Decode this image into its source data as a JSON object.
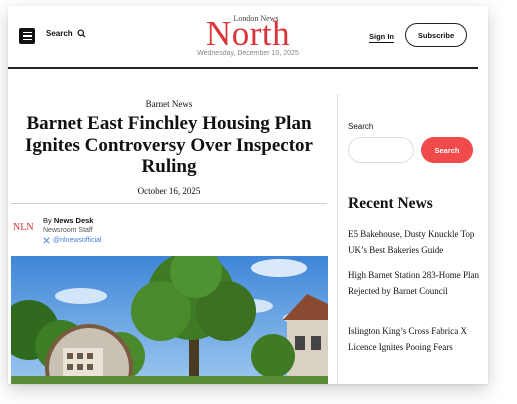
{
  "header": {
    "search_label": "Search",
    "logo_small": "London News",
    "logo_big": "North",
    "date": "Wednesday, December 10, 2025",
    "signin_label": "Sign In",
    "subscribe_label": "Subscribe"
  },
  "article": {
    "category": "Barnet News",
    "headline": "Barnet East Finchley Housing Plan Ignites Controversy Over Inspector Ruling",
    "date": "October 16, 2025",
    "author_logo": "NLN",
    "author_by": "By",
    "author_name": "News Desk",
    "author_role": "Newsroom Staff",
    "author_handle": "@nlnewsofficial"
  },
  "sidebar": {
    "search_label": "Search",
    "search_placeholder": "",
    "search_button": "Search",
    "recent_title": "Recent News",
    "recent_items": [
      "E5 Bakehouse, Dusty Knuckle Top UK’s Best Bakeries Guide",
      "High Barnet Station 283-Home Plan Rejected by Barnet Council",
      "Islington King’s Cross Fabrica X Licence Ignites Pooing Fears"
    ]
  },
  "colors": {
    "brand_red": "#d9353a",
    "button_red": "#f04a4a",
    "link_blue": "#4a7bd8"
  },
  "icons": [
    "menu-icon",
    "search-icon",
    "x-logo-icon"
  ]
}
